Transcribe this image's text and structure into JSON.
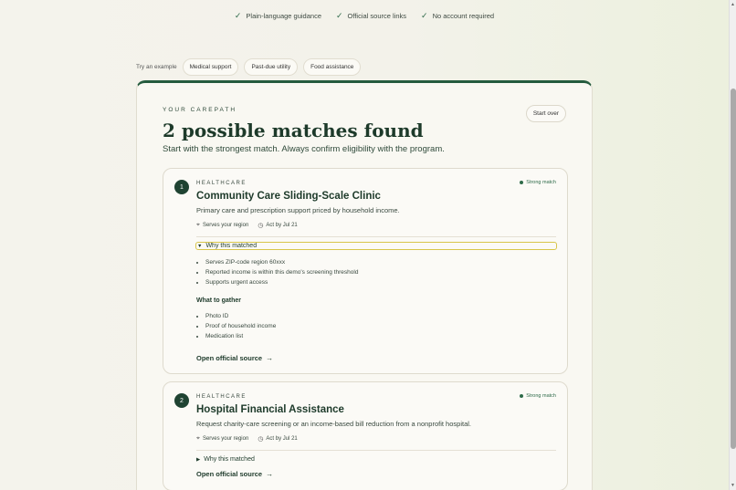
{
  "benefits": [
    "Plain-language guidance",
    "Official source links",
    "No account required"
  ],
  "examples": {
    "label": "Try an example",
    "chips": [
      "Medical support",
      "Past-due utility",
      "Food assistance"
    ]
  },
  "panel": {
    "eyebrow": "YOUR CAREPATH",
    "start_over": "Start over",
    "heading": "2 possible matches found",
    "subheading": "Start with the strongest match. Always confirm eligibility with the program."
  },
  "results": [
    {
      "number": "1",
      "category": "HEALTHCARE",
      "match": "Strong match",
      "title": "Community Care Sliding-Scale Clinic",
      "description": "Primary care and prescription support priced by household income.",
      "region": "Serves your region",
      "deadline": "Act by Jul 21",
      "why_label": "Why this matched",
      "reasons": [
        "Serves ZIP-code region 60xxx",
        "Reported income is within this demo's screening threshold",
        "Supports urgent access"
      ],
      "gather_heading": "What to gather",
      "gather": [
        "Photo ID",
        "Proof of household income",
        "Medication list"
      ],
      "open_label": "Open official source"
    },
    {
      "number": "2",
      "category": "HEALTHCARE",
      "match": "Strong match",
      "title": "Hospital Financial Assistance",
      "description": "Request charity-care screening or an income-based bill reduction from a nonprofit hospital.",
      "region": "Serves your region",
      "deadline": "Act by Jul 21",
      "why_label": "Why this matched",
      "open_label": "Open official source"
    }
  ],
  "colors": {
    "accent": "#255b3e",
    "focus": "#d8c64a"
  },
  "icons": [
    "check-icon",
    "location-pin-icon",
    "clock-icon",
    "arrow-right-icon",
    "disclosure-triangle-icon"
  ]
}
